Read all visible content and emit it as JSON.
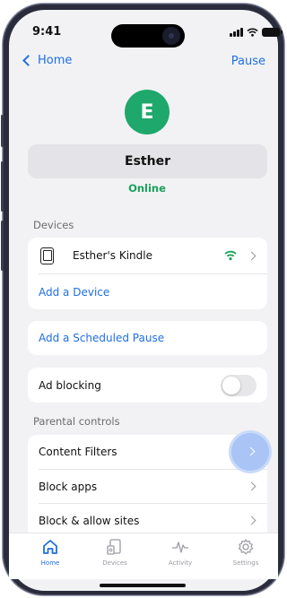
{
  "status_bar": {
    "time": "9:41"
  },
  "nav": {
    "back_label": "Home",
    "action_label": "Pause"
  },
  "profile": {
    "initial": "E",
    "name": "Esther",
    "status": "Online"
  },
  "devices": {
    "section_label": "Devices",
    "items": [
      {
        "name": "Esther's Kindle",
        "icon": "tablet-icon",
        "status_icon": "wifi-icon"
      }
    ],
    "add_label": "Add a Device"
  },
  "scheduled_pause": {
    "label": "Add a Scheduled Pause"
  },
  "ad_blocking": {
    "label": "Ad blocking",
    "enabled": false
  },
  "parental_controls": {
    "section_label": "Parental controls",
    "items": [
      {
        "label": "Content Filters"
      },
      {
        "label": "Block apps"
      },
      {
        "label": "Block & allow sites"
      }
    ]
  },
  "tab_bar": {
    "tabs": [
      {
        "label": "Home",
        "icon": "home-icon",
        "active": true
      },
      {
        "label": "Devices",
        "icon": "devices-icon",
        "active": false
      },
      {
        "label": "Activity",
        "icon": "activity-icon",
        "active": false
      },
      {
        "label": "Settings",
        "icon": "settings-icon",
        "active": false
      }
    ]
  },
  "colors": {
    "accent": "#1f6fe0",
    "online": "#1aa15a",
    "avatar": "#1ea86b",
    "wifi": "#1aa15a"
  }
}
